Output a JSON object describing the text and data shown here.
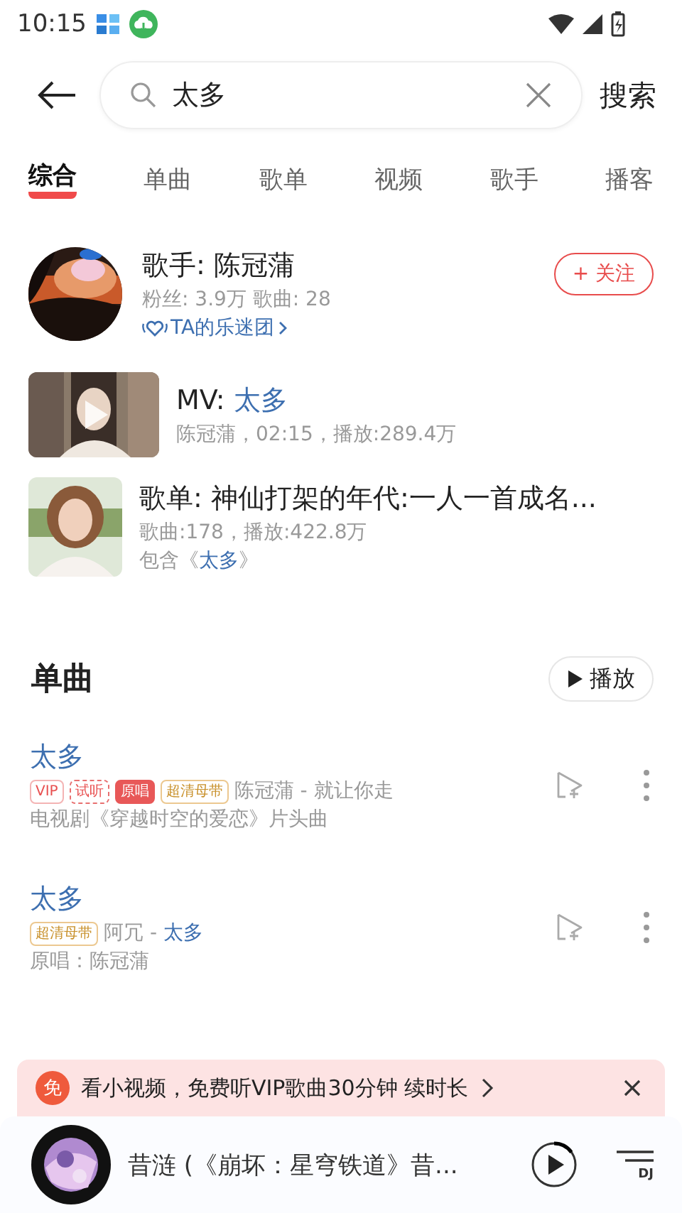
{
  "status_bar": {
    "time": "10:15"
  },
  "search": {
    "value": "太多",
    "button": "搜索"
  },
  "tabs": [
    {
      "label": "综合",
      "selected": true
    },
    {
      "label": "单曲",
      "selected": false
    },
    {
      "label": "歌单",
      "selected": false
    },
    {
      "label": "视频",
      "selected": false
    },
    {
      "label": "歌手",
      "selected": false
    },
    {
      "label": "播客",
      "selected": false
    }
  ],
  "artist": {
    "title": "歌手: 陈冠蒲",
    "stats": "粉丝: 3.9万 歌曲: 28",
    "fan_club": "TA的乐迷团",
    "follow": "+ 关注"
  },
  "mv": {
    "prefix": "MV: ",
    "title": "太多",
    "meta": "陈冠蒲，02:15，播放:289.4万"
  },
  "playlist": {
    "title": "歌单: 神仙打架的年代:一人一首成名...",
    "meta": "歌曲:178，播放:422.8万",
    "contains_prefix": "包含《",
    "contains_title": "太多",
    "contains_suffix": "》"
  },
  "songs_section": {
    "title": "单曲",
    "play_button": "播放"
  },
  "songs": [
    {
      "title": "太多",
      "tags": [
        {
          "kind": "vip",
          "label": "VIP"
        },
        {
          "kind": "trial",
          "label": "试听"
        },
        {
          "kind": "original",
          "label": "原唱"
        },
        {
          "kind": "hq",
          "label": "超清母带"
        }
      ],
      "artist": "陈冠蒲",
      "separator": " - ",
      "album": "就让你走",
      "album_linked": false,
      "note": "电视剧《穿越时空的爱恋》片头曲"
    },
    {
      "title": "太多",
      "tags": [
        {
          "kind": "hq",
          "label": "超清母带"
        }
      ],
      "artist": "阿冗",
      "separator": " - ",
      "album": "太多",
      "album_linked": true,
      "note": "原唱：陈冠蒲"
    }
  ],
  "banner": {
    "badge": "免",
    "text": "看小视频，免费听VIP歌曲30分钟 续时长"
  },
  "player": {
    "title": "昔涟 (《崩坏：星穹铁道》昔...",
    "level": 0.15,
    "playlist_label": "DJ"
  }
}
